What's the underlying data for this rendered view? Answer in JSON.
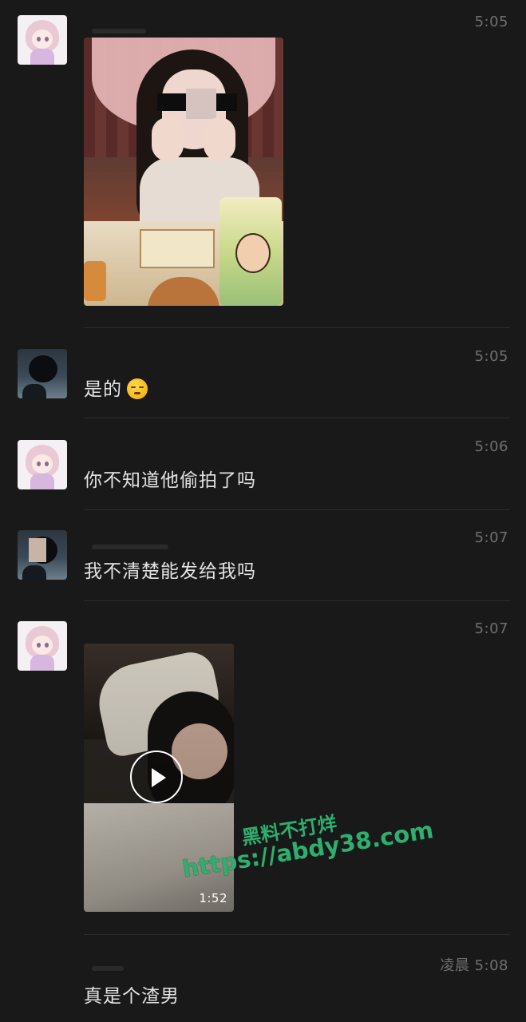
{
  "messages": [
    {
      "id": 1,
      "sender": "girl",
      "type": "image",
      "time": "5:05"
    },
    {
      "id": 2,
      "sender": "other",
      "type": "text",
      "time": "5:05",
      "text": "是的",
      "emoji": "pensive-face"
    },
    {
      "id": 3,
      "sender": "girl",
      "type": "text",
      "time": "5:06",
      "text": "你不知道他偷拍了吗"
    },
    {
      "id": 4,
      "sender": "other",
      "type": "text",
      "time": "5:07",
      "text": "我不清楚能发给我吗"
    },
    {
      "id": 5,
      "sender": "girl",
      "type": "video",
      "time": "5:07",
      "duration": "1:52"
    },
    {
      "id": 6,
      "sender": "other",
      "type": "text",
      "time": "凌晨 5:08",
      "text": "真是个渣男"
    }
  ],
  "watermark": {
    "title": "黑料不打烊",
    "url": "https://abdy38.com",
    "color": "#2fae6f"
  },
  "icons": [
    "play-icon",
    "pensive-face-emoji"
  ],
  "colors": {
    "background": "#191919",
    "text": "#e3e3e3",
    "time": "#6f6f6f",
    "divider": "#2d2d2d"
  }
}
